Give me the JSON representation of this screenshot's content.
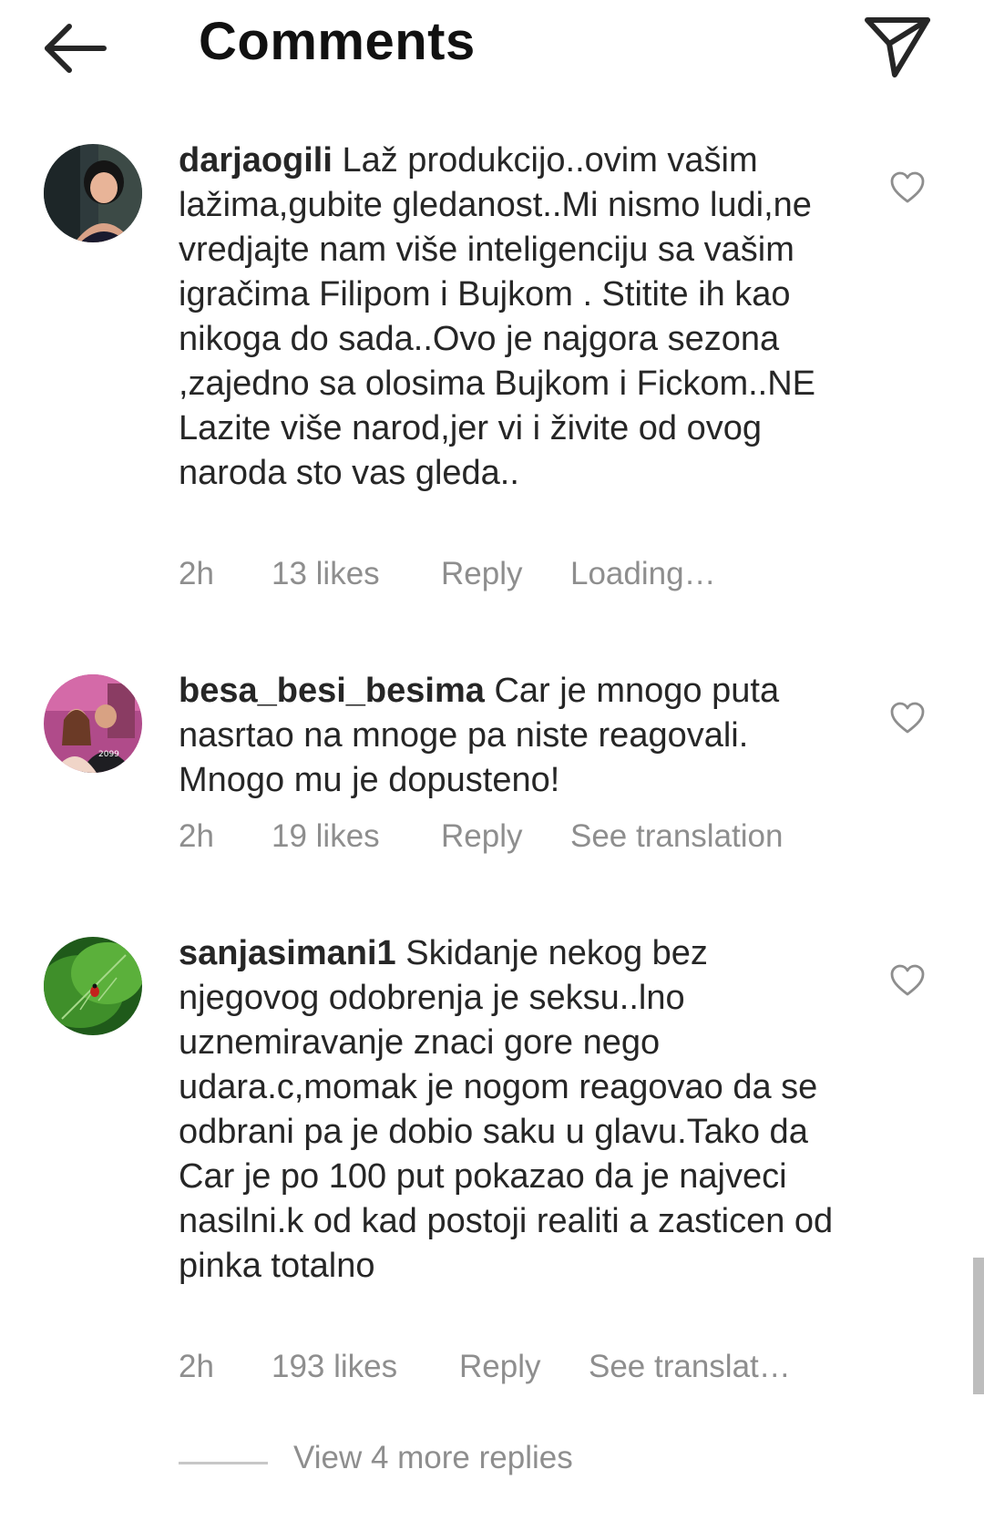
{
  "header": {
    "title": "Comments",
    "back_icon": "arrow-left-icon",
    "send_icon": "paper-plane-icon"
  },
  "comments": [
    {
      "username": "darjaogili",
      "text": "Laž produkcijo..ovim vašim lažima,gubite gledanost..Mi nismo ludi,ne vredjajte nam više inteligenciju sa vašim igračima  Filipom i Bujkom . Stitite ih kao nikoga do sada..Ovo je najgora sezona ,zajedno sa olosima Bujkom i Fickom..NE Lazite više narod,jer vi i živite od ovog naroda sto vas gleda..",
      "time": "2h",
      "likes": "13 likes",
      "reply": "Reply",
      "extra": "Loading…"
    },
    {
      "username": "besa_besi_besima",
      "text": "Car je mnogo puta nasrtao na mnoge pa niste reagovali. Mnogo mu je dopusteno!",
      "time": "2h",
      "likes": "19 likes",
      "reply": "Reply",
      "extra": "See translation"
    },
    {
      "username": "sanjasimani1",
      "text": "Skidanje nekog bez njegovog odobrenja je seksu..lno uznemiravanje znaci gore nego udara.c,momak je nogom reagovao da se odbrani pa je dobio saku u glavu.Tako da Car je po 100 put pokazao da je najveci nasilni.k od kad postoji realiti a zasticen od pinka totalno",
      "time": "2h",
      "likes": "193 likes",
      "reply": "Reply",
      "extra": "See translat…"
    }
  ],
  "view_more_replies": "View 4 more replies",
  "colors": {
    "text": "#262626",
    "meta": "#8e8e8e",
    "icon": "#262626",
    "divider": "#c7c7c7",
    "background": "#ffffff"
  }
}
